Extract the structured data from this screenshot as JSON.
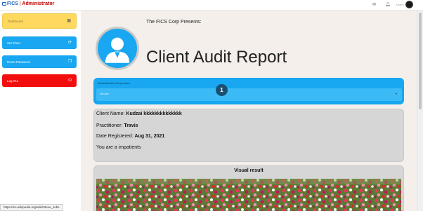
{
  "brand": {
    "name": "FICS",
    "separator": "|",
    "role": "Administrator"
  },
  "topbar": {
    "icons": [
      "mail-icon",
      "bell-icon"
    ],
    "user_label": "Users",
    "avatar": "user-avatar"
  },
  "sidebar": {
    "items": [
      {
        "label": "Dashboard",
        "icon": "grid-icon",
        "color": "#ffd95e"
      },
      {
        "label": "Set Timer",
        "icon": "timer-icon",
        "color": "#18a7f0"
      },
      {
        "label": "Reset Password",
        "icon": "copy-icon",
        "color": "#18a7f0"
      },
      {
        "label": "Log Out",
        "icon": "power-icon",
        "color": "#f20e0e"
      }
    ]
  },
  "header": {
    "presents": "The FICS Corp Presents:",
    "title": "Client Audit Report",
    "avatar_icon": "user-icon"
  },
  "dropdown": {
    "label": "Administrative Drop-down",
    "value": "choose",
    "badge": "1"
  },
  "client": {
    "name_label": "Client Name:",
    "name_value": "Kudzai kkkkkkkkkkkkkk",
    "practitioner_label": "Practitioner:",
    "practitioner_value": "Travis",
    "date_label": "Date Registered:",
    "date_value": "Aug 31, 2021",
    "status_text": "You are a impatients"
  },
  "visual": {
    "title": "Visual result",
    "image": "flower-field-photo"
  },
  "status_bar": {
    "url": "https://en.wikipedia.org/wiki/Steve_Jobs"
  },
  "colors": {
    "accent_blue": "#18a7f0",
    "dashboard_yellow": "#ffd95e",
    "logout_red": "#f20e0e",
    "brand_blue": "#1e63b8",
    "brand_red": "#c00000"
  }
}
